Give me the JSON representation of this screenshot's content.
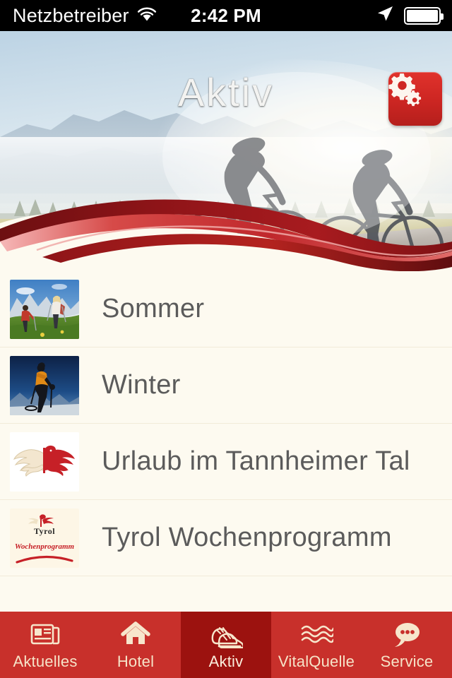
{
  "statusbar": {
    "carrier": "Netzbetreiber",
    "time": "2:42 PM",
    "wifi_icon": "wifi-icon",
    "location_icon": "location-arrow-icon",
    "battery_icon": "battery-full-icon"
  },
  "header": {
    "title": "Aktiv",
    "settings_icon": "gears-icon",
    "hero_image": "cyclists-mountain-landscape-photo",
    "swoosh": "red-wave-decoration"
  },
  "list": {
    "items": [
      {
        "label": "Sommer",
        "thumb": "hikers-alpine-meadow-thumbnail"
      },
      {
        "label": "Winter",
        "thumb": "winter-skier-silhouette-thumbnail"
      },
      {
        "label": "Urlaub im Tannheimer Tal",
        "thumb": "tyrol-eagle-emblem-thumbnail"
      },
      {
        "label": "Tyrol Wochenprogramm",
        "thumb": "tyrol-wochenprogramm-logo-thumbnail"
      }
    ]
  },
  "tabbar": {
    "active_index": 2,
    "tabs": [
      {
        "label": "Aktuelles",
        "icon": "newspaper-icon"
      },
      {
        "label": "Hotel",
        "icon": "house-icon"
      },
      {
        "label": "Aktiv",
        "icon": "running-shoes-icon"
      },
      {
        "label": "VitalQuelle",
        "icon": "water-waves-icon"
      },
      {
        "label": "Service",
        "icon": "speech-bubble-icon"
      }
    ]
  },
  "colors": {
    "brand_red": "#C8302B",
    "active_tab_red": "#9C120F",
    "page_background": "#FDFAF0",
    "row_text": "#5B5B5B",
    "tab_icon": "#F7E6CC"
  }
}
